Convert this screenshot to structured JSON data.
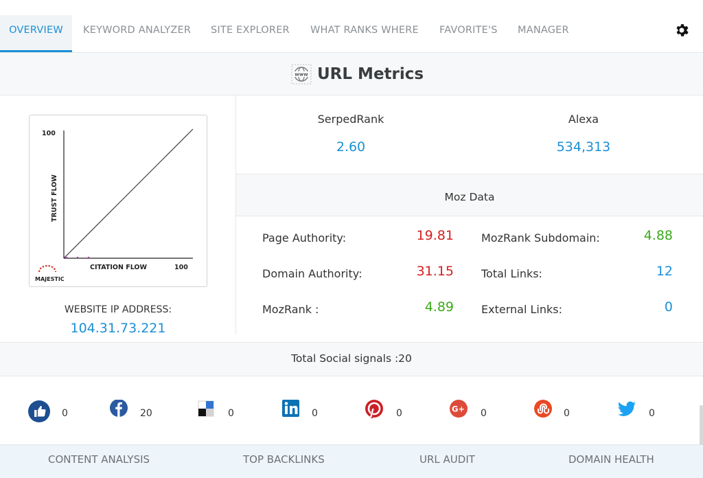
{
  "nav": {
    "tabs": [
      {
        "label": "OVERVIEW",
        "active": true
      },
      {
        "label": "KEYWORD ANALYZER"
      },
      {
        "label": "SITE EXPLORER"
      },
      {
        "label": "WHAT RANKS WHERE"
      },
      {
        "label": "FAVORITE'S"
      },
      {
        "label": "MANAGER"
      }
    ],
    "settings_icon": "gear-icon"
  },
  "header": {
    "title": "URL Metrics",
    "icon": "www-globe-icon"
  },
  "majestic_chart": {
    "y_max_label": "100",
    "x_max_label": "100",
    "y_axis_label": "TRUST FLOW",
    "x_axis_label": "CITATION FLOW",
    "brand": "MAJESTIC"
  },
  "website_ip": {
    "label": "WEBSITE IP ADDRESS:",
    "value": "104.31.73.221"
  },
  "serped_rank": {
    "label": "SerpedRank",
    "value": "2.60"
  },
  "alexa": {
    "label": "Alexa",
    "value": "534,313"
  },
  "moz": {
    "title": "Moz Data",
    "page_authority": {
      "label": "Page Authority:",
      "value": "19.81"
    },
    "domain_authority": {
      "label": "Domain Authority:",
      "value": "31.15"
    },
    "mozrank": {
      "label": "MozRank :",
      "value": "4.89"
    },
    "mozrank_subdomain": {
      "label": "MozRank Subdomain:",
      "value": "4.88"
    },
    "total_links": {
      "label": "Total Links:",
      "value": "12"
    },
    "external_links": {
      "label": "External Links:",
      "value": "0"
    }
  },
  "social": {
    "title": "Total Social signals :20",
    "items": [
      {
        "icon": "thumbs-up-icon",
        "count": "0"
      },
      {
        "icon": "facebook-icon",
        "count": "20"
      },
      {
        "icon": "delicious-icon",
        "count": "0"
      },
      {
        "icon": "linkedin-icon",
        "count": "0"
      },
      {
        "icon": "pinterest-icon",
        "count": "0"
      },
      {
        "icon": "google-plus-icon",
        "count": "0"
      },
      {
        "icon": "stumbleupon-icon",
        "count": "0"
      },
      {
        "icon": "twitter-icon",
        "count": "0"
      }
    ]
  },
  "bottom_tabs": [
    {
      "label": "CONTENT ANALYSIS"
    },
    {
      "label": "TOP BACKLINKS"
    },
    {
      "label": "URL AUDIT"
    },
    {
      "label": "DOMAIN HEALTH"
    }
  ],
  "colors": {
    "accent": "#1a8fd6",
    "red": "#d42020",
    "green": "#3aaa1a"
  }
}
